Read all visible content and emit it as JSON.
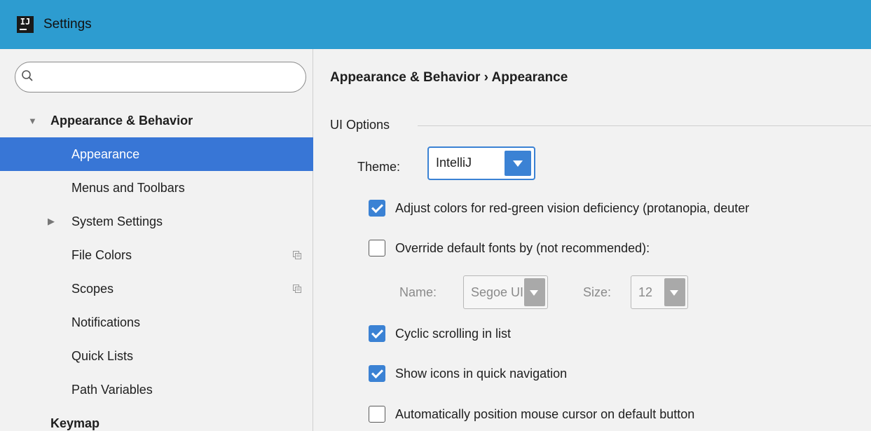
{
  "window": {
    "title": "Settings",
    "logo_text": "IJ"
  },
  "search": {
    "placeholder": "",
    "value": ""
  },
  "sidebar": {
    "items": [
      {
        "label": "Appearance & Behavior"
      },
      {
        "label": "Appearance"
      },
      {
        "label": "Menus and Toolbars"
      },
      {
        "label": "System Settings"
      },
      {
        "label": "File Colors"
      },
      {
        "label": "Scopes"
      },
      {
        "label": "Notifications"
      },
      {
        "label": "Quick Lists"
      },
      {
        "label": "Path Variables"
      },
      {
        "label": "Keymap"
      }
    ]
  },
  "main": {
    "breadcrumb": "Appearance & Behavior › Appearance",
    "section_title": "UI Options",
    "theme": {
      "label": "Theme:",
      "value": "IntelliJ"
    },
    "options": [
      {
        "label": "Adjust colors for red-green vision deficiency (protanopia, deuter",
        "checked": true
      },
      {
        "label": "Override default fonts by (not recommended):",
        "checked": false
      },
      {
        "label": "Cyclic scrolling in list",
        "checked": true
      },
      {
        "label": "Show icons in quick navigation",
        "checked": true
      },
      {
        "label": "Automatically position mouse cursor on default button",
        "checked": false
      }
    ],
    "font": {
      "name_label": "Name:",
      "name_value": "Segoe UI",
      "size_label": "Size:",
      "size_value": "12"
    }
  },
  "colors": {
    "titlebar": "#2d9cd0",
    "accent": "#3876d6",
    "checkbox": "#3b82d4"
  }
}
